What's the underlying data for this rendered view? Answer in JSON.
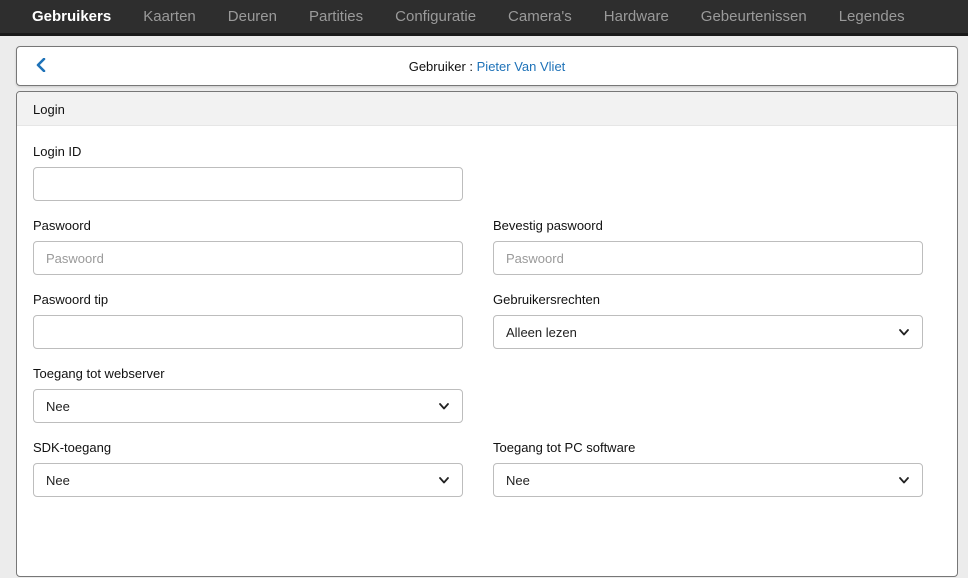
{
  "nav": {
    "items": [
      {
        "label": "Gebruikers",
        "active": true
      },
      {
        "label": "Kaarten"
      },
      {
        "label": "Deuren"
      },
      {
        "label": "Partities"
      },
      {
        "label": "Configuratie"
      },
      {
        "label": "Camera's"
      },
      {
        "label": "Hardware"
      },
      {
        "label": "Gebeurtenissen"
      },
      {
        "label": "Legendes"
      }
    ]
  },
  "header": {
    "prefix": "Gebruiker : ",
    "user_name": "Pieter Van Vliet",
    "back_icon": "chevron-left-icon"
  },
  "panel": {
    "title": "Login",
    "login_id": {
      "label": "Login ID",
      "value": "",
      "placeholder": ""
    },
    "password": {
      "label": "Paswoord",
      "value": "",
      "placeholder": "Paswoord"
    },
    "confirm_password": {
      "label": "Bevestig paswoord",
      "value": "",
      "placeholder": "Paswoord"
    },
    "password_hint": {
      "label": "Paswoord tip",
      "value": "",
      "placeholder": ""
    },
    "user_rights": {
      "label": "Gebruikersrechten",
      "selected": "Alleen lezen"
    },
    "webserver_access": {
      "label": "Toegang tot webserver",
      "selected": "Nee"
    },
    "sdk_access": {
      "label": "SDK-toegang",
      "selected": "Nee"
    },
    "pc_software_access": {
      "label": "Toegang tot PC software",
      "selected": "Nee"
    }
  },
  "colors": {
    "nav_bg": "#2e2e2e",
    "link": "#1e72b8"
  }
}
